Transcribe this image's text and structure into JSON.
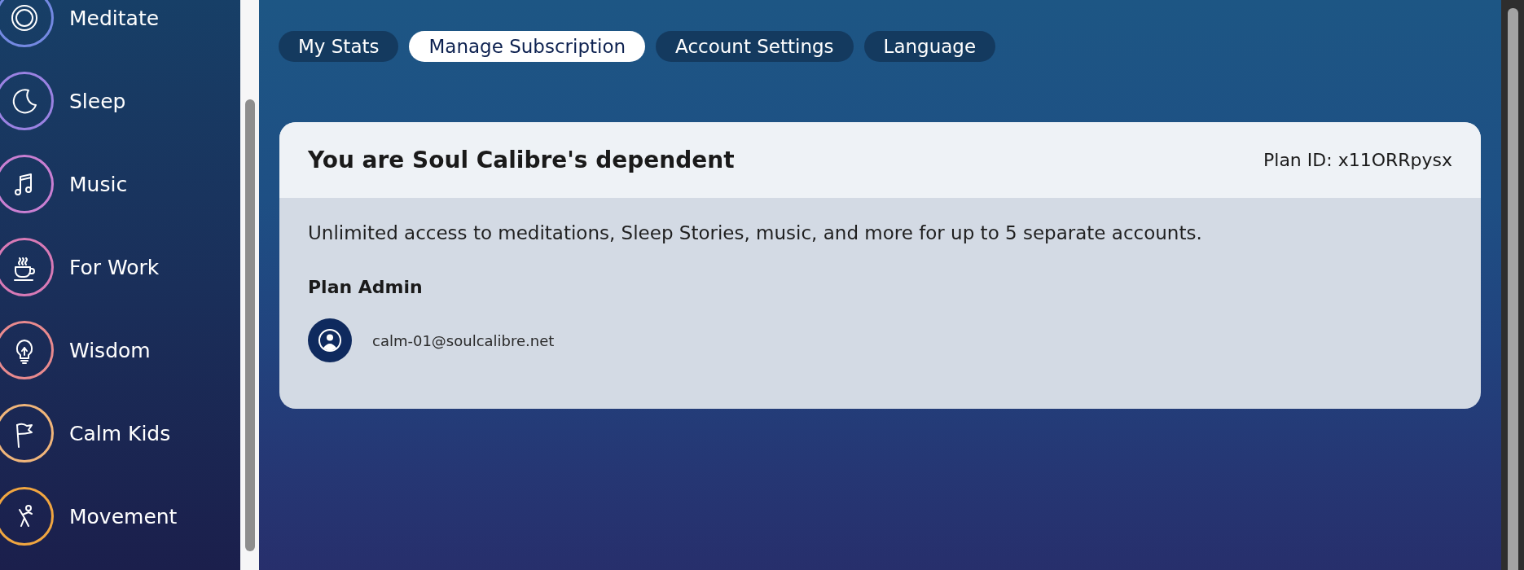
{
  "sidebar": {
    "items": [
      {
        "label": "Meditate",
        "color": "#7489e2",
        "selected": false
      },
      {
        "label": "Sleep",
        "color": "#9a82e2",
        "selected": false
      },
      {
        "label": "Music",
        "color": "#c97fd2",
        "selected": false
      },
      {
        "label": "For Work",
        "color": "#d87ab6",
        "selected": false
      },
      {
        "label": "Wisdom",
        "color": "#e98a8e",
        "selected": false
      },
      {
        "label": "Calm Kids",
        "color": "#f0b57a",
        "selected": false
      },
      {
        "label": "Movement",
        "color": "#f1a640",
        "selected": false
      }
    ]
  },
  "tabs": [
    {
      "label": "My Stats",
      "selected": false
    },
    {
      "label": "Manage Subscription",
      "selected": true
    },
    {
      "label": "Account Settings",
      "selected": false
    },
    {
      "label": "Language",
      "selected": false
    }
  ],
  "card": {
    "title": "You are Soul Calibre's dependent",
    "plan_id": "Plan ID: x11ORRpysx",
    "description": "Unlimited access to meditations, Sleep Stories, music, and more for up to 5 separate accounts.",
    "admin_heading": "Plan Admin",
    "admin_email": "calm-01@soulcalibre.net"
  }
}
